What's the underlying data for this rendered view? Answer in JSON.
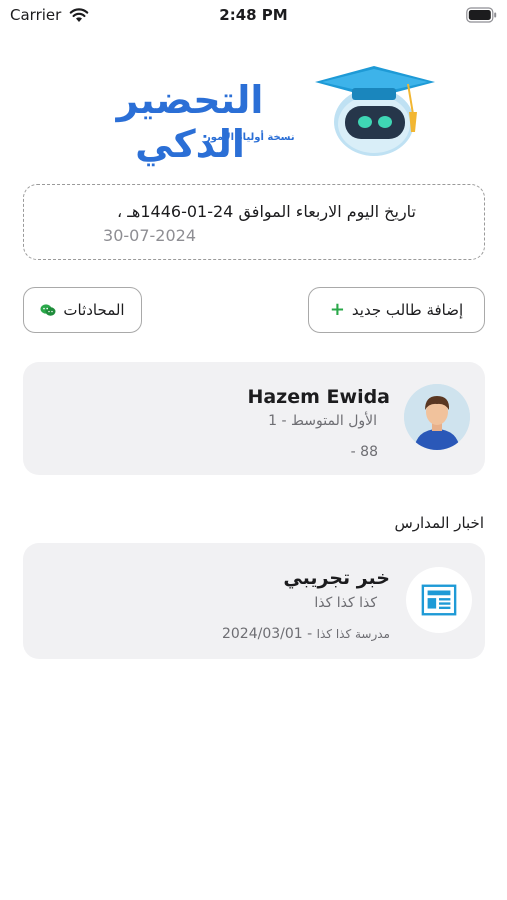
{
  "status_bar": {
    "carrier": "Carrier",
    "time": "2:48 PM"
  },
  "logo": {
    "title": "التحضير الذكي",
    "subtitle": "نسخة أولياء الأمور",
    "icon": "graduation-cap-robot-icon"
  },
  "date": {
    "hijri_line": "تاريخ اليوم الاربعاء الموافق 24-01-1446هـ ،",
    "gregorian": "30-07-2024"
  },
  "actions": {
    "add_student_label": "إضافة طالب جديد",
    "add_icon": "plus-icon",
    "chats_label": "المحادثات",
    "chats_icon": "chat-bubbles-icon"
  },
  "student": {
    "name": "Hazem Ewida",
    "grade": "الأول المتوسط - 1",
    "number": "- 88",
    "avatar_icon": "student-avatar-icon"
  },
  "news_section": {
    "title": "اخبار المدارس",
    "items": [
      {
        "title": "خبر تجريبي",
        "body": "كذا كذا كذا",
        "school": "مدرسة كذا كذا",
        "date": "2024/03/01",
        "separator": "-",
        "icon": "newspaper-icon"
      }
    ]
  },
  "colors": {
    "brand_blue": "#2b6fd6",
    "card_bg": "#f1f1f3",
    "plus_green": "#2aa84a",
    "icon_blue": "#1e9ad6"
  }
}
